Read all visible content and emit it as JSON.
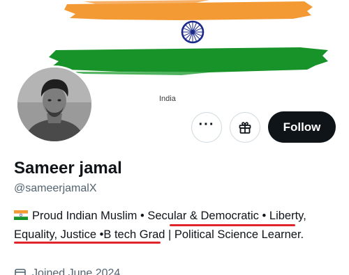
{
  "banner": {
    "caption": "India",
    "colors": {
      "saffron": "#ff9933",
      "green": "#138808",
      "chakra": "#000080"
    }
  },
  "profile": {
    "display_name": "Sameer jamal",
    "handle": "@sameerjamalX",
    "follow_label": "Follow",
    "more_icon": "more-dots-icon",
    "gift_icon": "gift-icon",
    "bio": {
      "flag_icon": "india-flag-emoji",
      "segments": [
        "Proud Indian Muslim",
        "•",
        "Secular & Democratic",
        "•",
        "Liberty, Equality, Justice",
        "•",
        "B tech Grad | Political Science Learner."
      ]
    },
    "joined": "Joined June 2024",
    "joined_icon": "calendar-icon"
  },
  "accent_colors": {
    "follow_bg": "#0f1419",
    "underline": "#e1232b",
    "secondary_text": "#536471"
  }
}
